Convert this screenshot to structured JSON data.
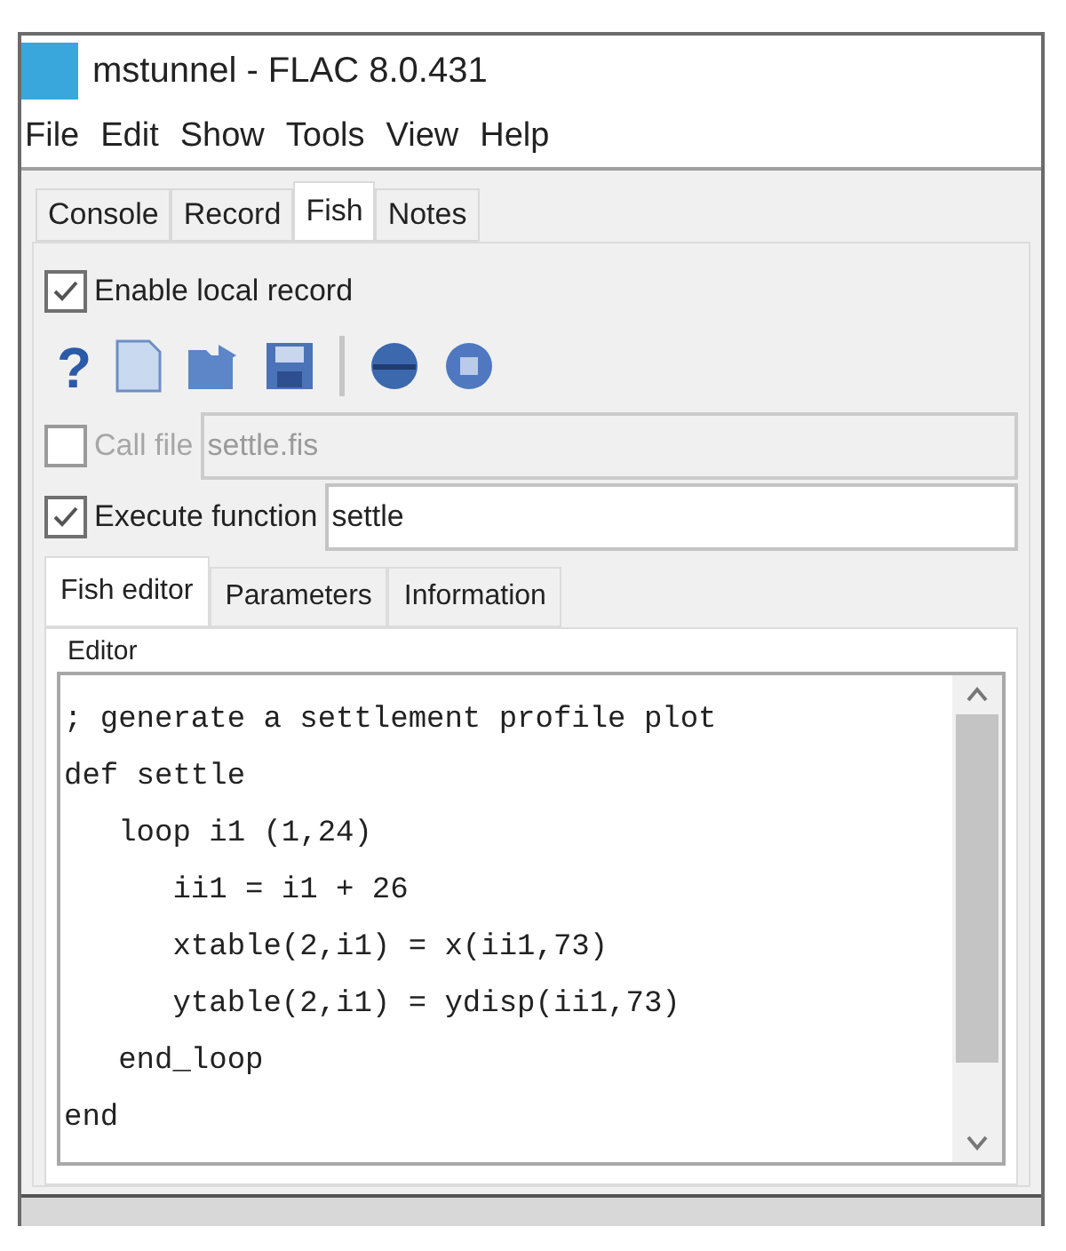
{
  "window": {
    "title": "mstunnel - FLAC 8.0.431"
  },
  "menu": [
    "File",
    "Edit",
    "Show",
    "Tools",
    "View",
    "Help"
  ],
  "tabs": [
    {
      "label": "Console",
      "selected": false
    },
    {
      "label": "Record",
      "selected": false
    },
    {
      "label": "Fish",
      "selected": true
    },
    {
      "label": "Notes",
      "selected": false
    }
  ],
  "toolbar": {
    "help_symbol": "?"
  },
  "enable_local_record": {
    "label": "Enable local record",
    "checked": true
  },
  "call_file": {
    "label": "Call file",
    "checked": false,
    "disabled": true,
    "value": "settle.fis"
  },
  "execute_function": {
    "label": "Execute function",
    "checked": true,
    "value": "settle"
  },
  "subtabs": [
    {
      "label": "Fish editor",
      "selected": true
    },
    {
      "label": "Parameters",
      "selected": false
    },
    {
      "label": "Information",
      "selected": false
    }
  ],
  "editor": {
    "title": "Editor",
    "lines": [
      "; generate a settlement profile plot",
      "def settle",
      "   loop i1 (1,24)",
      "      ii1 = i1 + 26",
      "      xtable(2,i1) = x(ii1,73)",
      "      ytable(2,i1) = ydisp(ii1,73)",
      "   end_loop",
      "end"
    ]
  }
}
